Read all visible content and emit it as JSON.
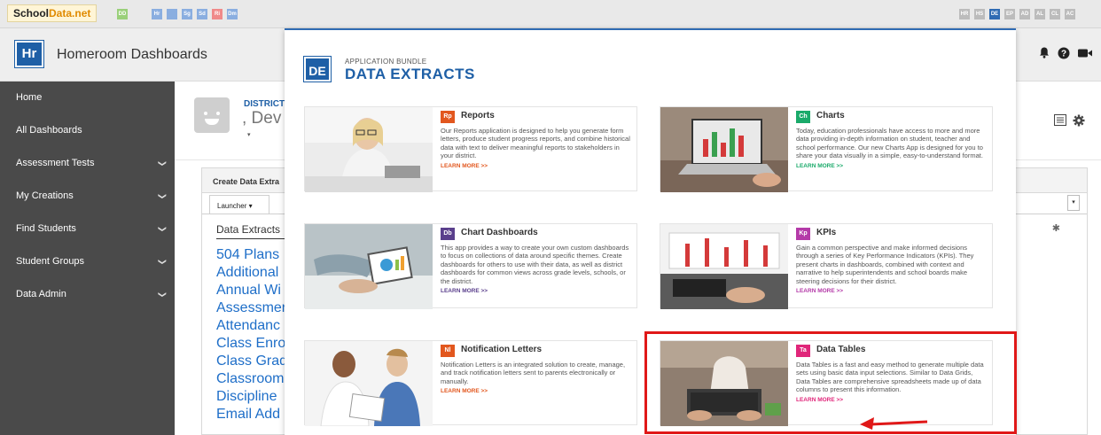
{
  "topbar": {
    "logo_part1": "School",
    "logo_part2": "Data.net",
    "left_tiles": [
      {
        "label": "DD",
        "color": "#9ad07a"
      },
      {
        "label": "Hr",
        "color": "#8aaee0"
      },
      {
        "label": "",
        "color": "#8aaee0"
      },
      {
        "label": "Sg",
        "color": "#8aaee0"
      },
      {
        "label": "Sd",
        "color": "#8aaee0"
      },
      {
        "label": "Ri",
        "color": "#f08a8a"
      },
      {
        "label": "Dm",
        "color": "#8aaee0"
      }
    ],
    "right_tiles": [
      {
        "label": "HR",
        "color": "#bcbcbc"
      },
      {
        "label": "HS",
        "color": "#bcbcbc"
      },
      {
        "label": "DE",
        "color": "#2f6bb3"
      },
      {
        "label": "EP",
        "color": "#bcbcbc"
      },
      {
        "label": "AD",
        "color": "#bcbcbc"
      },
      {
        "label": "AL",
        "color": "#bcbcbc"
      },
      {
        "label": "CL",
        "color": "#bcbcbc"
      },
      {
        "label": "AC",
        "color": "#bcbcbc"
      }
    ]
  },
  "header": {
    "badge": "Hr",
    "title": "Homeroom Dashboards",
    "icons": [
      "bell-icon",
      "help-icon",
      "video-icon"
    ]
  },
  "sidebar": {
    "items": [
      {
        "label": "Home",
        "chevron": false
      },
      {
        "label": "All Dashboards",
        "chevron": false
      },
      {
        "label": "Assessment Tests",
        "chevron": true
      },
      {
        "label": "My Creations",
        "chevron": true
      },
      {
        "label": "Find Students",
        "chevron": true
      },
      {
        "label": "Student Groups",
        "chevron": true
      },
      {
        "label": "Data Admin",
        "chevron": true
      }
    ]
  },
  "main": {
    "district_label": "DISTRICT",
    "user_name": ", Dev",
    "panel_title": "Create Data Extra",
    "launcher_label": "Launcher ▾",
    "extracts_label": "Data Extracts",
    "links": [
      "504 Plans",
      "Additional",
      "Annual Wi",
      "Assessmen",
      "Attendanc",
      "Class Enro",
      "Class Grad",
      "Classroom",
      "Discipline",
      "Email Add"
    ]
  },
  "overlay": {
    "badge": "DE",
    "bundle_label": "APPLICATION BUNDLE",
    "bundle_title": "DATA EXTRACTS",
    "cards": [
      {
        "id": "reports",
        "badge": "Rp",
        "badge_color": "#e2571e",
        "title": "Reports",
        "description": "Our Reports application is designed to help you generate form letters, produce student progress reports, and combine historical data with text to deliver meaningful reports to stakeholders in your district.",
        "more": "LEARN MORE >>",
        "more_color": "#e2571e"
      },
      {
        "id": "charts",
        "badge": "Ch",
        "badge_color": "#1aaa6a",
        "title": "Charts",
        "description": "Today, education professionals have access to more and more data providing in-depth information on student, teacher and school performance. Our new Charts App is designed for you to share your data visually in a simple, easy-to-understand format.",
        "more": "LEARN MORE >>",
        "more_color": "#1aaa6a"
      },
      {
        "id": "chart-dashboards",
        "badge": "Db",
        "badge_color": "#5a3f8c",
        "title": "Chart Dashboards",
        "description": "This app provides a way to create your own custom dashboards to focus on collections of data around specific themes. Create dashboards for others to use with their data, as well as district dashboards for common views across grade levels, schools, or the district.",
        "more": "LEARN MORE >>",
        "more_color": "#5a3f8c"
      },
      {
        "id": "kpis",
        "badge": "Kp",
        "badge_color": "#b43aa8",
        "title": "KPIs",
        "description": "Gain a common perspective and make informed decisions through a series of Key Performance Indicators (KPIs). They present charts in dashboards, combined with context and narrative to help superintendents and school boards make steering decisions for their district.",
        "more": "LEARN MORE >>",
        "more_color": "#b43aa8"
      },
      {
        "id": "notification-letters",
        "badge": "Nl",
        "badge_color": "#e2571e",
        "title": "Notification Letters",
        "description": "Notification Letters is an integrated solution to create, manage, and track notification letters sent to parents electronically or manually.",
        "more": "LEARN MORE >>",
        "more_color": "#e2571e"
      },
      {
        "id": "data-tables",
        "badge": "Ta",
        "badge_color": "#e0267a",
        "title": "Data Tables",
        "description": "Data Tables is a fast and easy method to generate multiple data sets using basic data input selections. Similar to Data Grids, Data Tables are comprehensive spreadsheets made up of data columns to present this information.",
        "more": "LEARN MORE >>",
        "more_color": "#e0267a"
      }
    ]
  },
  "colors": {
    "accent": "#1e5fa6",
    "sidebar_bg": "#4a4a4a",
    "highlight": "#e01818"
  }
}
